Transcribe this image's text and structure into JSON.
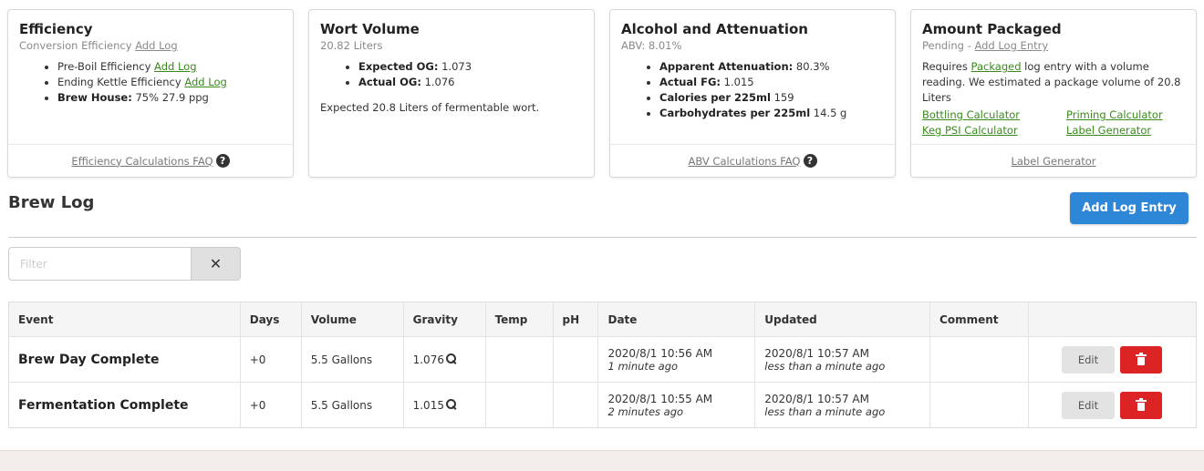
{
  "cards": {
    "efficiency": {
      "title": "Efficiency",
      "sub_text": "Conversion Efficiency",
      "sub_link": "Add Log",
      "items": [
        {
          "label": "Pre-Boil Efficiency",
          "link": "Add Log"
        },
        {
          "label": "Ending Kettle Efficiency",
          "link": "Add Log"
        },
        {
          "label": "Brew House:",
          "value": "75% 27.9 ppg"
        }
      ],
      "footer_link": "Efficiency Calculations FAQ"
    },
    "wort": {
      "title": "Wort Volume",
      "sub_text": "20.82 Liters",
      "items": [
        {
          "label": "Expected OG:",
          "value": "1.073"
        },
        {
          "label": "Actual OG:",
          "value": "1.076"
        }
      ],
      "note": "Expected 20.8 Liters of fermentable wort."
    },
    "alcohol": {
      "title": "Alcohol and Attenuation",
      "sub_text": "ABV: 8.01%",
      "items": [
        {
          "label": "Apparent Attenuation:",
          "value": "80.3%"
        },
        {
          "label": "Actual FG:",
          "value": "1.015"
        },
        {
          "label": "Calories per 225ml",
          "value": "159"
        },
        {
          "label": "Carbohydrates per 225ml",
          "value": "14.5 g"
        }
      ],
      "footer_link": "ABV Calculations FAQ"
    },
    "packaged": {
      "title": "Amount Packaged",
      "sub_text": "Pending -",
      "sub_link": "Add Log Entry",
      "text_before": "Requires",
      "text_link": "Packaged",
      "text_after": "log entry with a volume reading. We estimated a package volume of 20.8 Liters",
      "calculators": [
        "Bottling Calculator",
        "Priming Calculator",
        "Keg PSI Calculator",
        "Label Generator"
      ],
      "footer_link": "Label Generator"
    }
  },
  "help_glyph": "?",
  "brew_log": {
    "title": "Brew Log",
    "add_button": "Add Log Entry",
    "filter_placeholder": "Filter",
    "clear_glyph": "✕",
    "columns": [
      "Event",
      "Days",
      "Volume",
      "Gravity",
      "Temp",
      "pH",
      "Date",
      "Updated",
      "Comment",
      ""
    ],
    "rows": [
      {
        "event": "Brew Day Complete",
        "days": "+0",
        "volume": "5.5 Gallons",
        "gravity": "1.076",
        "temp": "",
        "ph": "",
        "date": "2020/8/1 10:56 AM",
        "date_rel": "1 minute ago",
        "updated": "2020/8/1 10:57 AM",
        "updated_rel": "less than a minute ago",
        "comment": "",
        "edit": "Edit"
      },
      {
        "event": "Fermentation Complete",
        "days": "+0",
        "volume": "5.5 Gallons",
        "gravity": "1.015",
        "temp": "",
        "ph": "",
        "date": "2020/8/1 10:55 AM",
        "date_rel": "2 minutes ago",
        "updated": "2020/8/1 10:57 AM",
        "updated_rel": "less than a minute ago",
        "comment": "",
        "edit": "Edit"
      }
    ]
  },
  "colors": {
    "link": "#3a8a1c",
    "primary_button": "#2e86d6",
    "delete_button": "#dc2424",
    "edit_button": "#e3e3e3",
    "footer_strip": "#f2efea"
  },
  "icons": [
    "question-circle-icon",
    "clear-x-icon",
    "magnifier-icon",
    "trash-icon"
  ]
}
